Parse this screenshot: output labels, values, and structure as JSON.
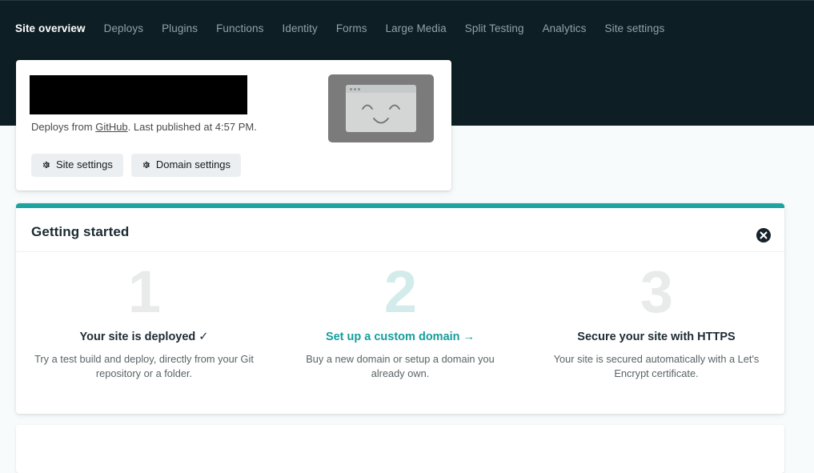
{
  "nav": {
    "items": [
      {
        "label": "Site overview",
        "active": true
      },
      {
        "label": "Deploys",
        "active": false
      },
      {
        "label": "Plugins",
        "active": false
      },
      {
        "label": "Functions",
        "active": false
      },
      {
        "label": "Identity",
        "active": false
      },
      {
        "label": "Forms",
        "active": false
      },
      {
        "label": "Large Media",
        "active": false
      },
      {
        "label": "Split Testing",
        "active": false
      },
      {
        "label": "Analytics",
        "active": false
      },
      {
        "label": "Site settings",
        "active": false
      }
    ]
  },
  "site_card": {
    "site_name_redacted": "",
    "deploy_prefix": "Deploys from ",
    "deploy_source": "GitHub",
    "deploy_suffix": ". Last published at 4:57 PM.",
    "buttons": [
      {
        "label": "Site settings",
        "icon": "gear-icon"
      },
      {
        "label": "Domain settings",
        "icon": "gear-icon"
      }
    ],
    "thumbnail_alt": "site-preview-placeholder"
  },
  "getting_started": {
    "title": "Getting started",
    "close_icon": "close-circle-icon",
    "accent_color": "#1da3a0",
    "steps": [
      {
        "number": "1",
        "title": "Your site is deployed ✓",
        "description": "Try a test build and deploy, directly from your Git repository or a folder.",
        "is_link": false,
        "number_color": "#e9eaea"
      },
      {
        "number": "2",
        "title": "Set up a custom domain →",
        "description": "Buy a new domain or setup a domain you already own.",
        "is_link": true,
        "number_color": "#d3eceb"
      },
      {
        "number": "3",
        "title": "Secure your site with HTTPS",
        "description": "Your site is secured automatically with a Let's Encrypt certificate.",
        "is_link": false,
        "number_color": "#e9eaea"
      }
    ]
  },
  "theme": {
    "header_bg": "#0e1e25",
    "page_bg": "#f7fbfb",
    "teal": "#1da3a0",
    "link_teal": "#159e9b"
  }
}
